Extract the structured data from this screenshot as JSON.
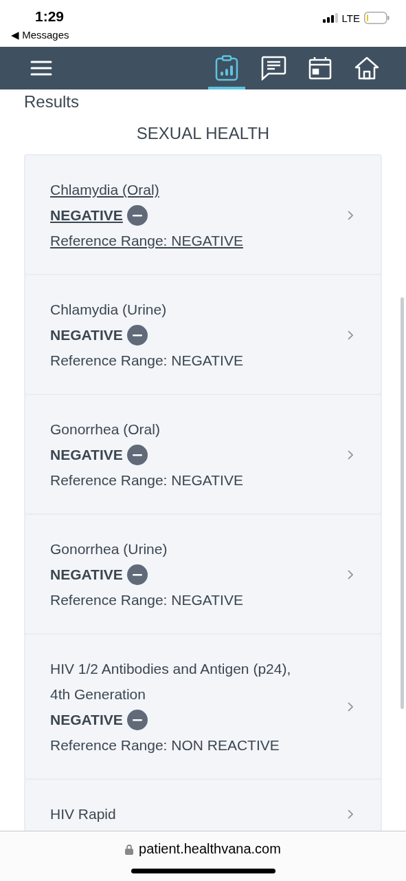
{
  "status_bar": {
    "time": "1:29",
    "back_label": "◀ Messages",
    "network": "LTE"
  },
  "nav": {
    "tabs": [
      {
        "kind": "results",
        "selected": true
      },
      {
        "kind": "messages",
        "selected": false
      },
      {
        "kind": "calendar",
        "selected": false
      },
      {
        "kind": "home",
        "selected": false
      }
    ]
  },
  "page_title": "Results",
  "section_title": "SEXUAL HEALTH",
  "results": [
    {
      "name": "Chlamydia (Oral)",
      "result": "NEGATIVE",
      "reference": "Reference Range: NEGATIVE",
      "selected": true
    },
    {
      "name": "Chlamydia (Urine)",
      "result": "NEGATIVE",
      "reference": "Reference Range: NEGATIVE",
      "selected": false
    },
    {
      "name": "Gonorrhea (Oral)",
      "result": "NEGATIVE",
      "reference": "Reference Range: NEGATIVE",
      "selected": false
    },
    {
      "name": "Gonorrhea (Urine)",
      "result": "NEGATIVE",
      "reference": "Reference Range: NEGATIVE",
      "selected": false
    },
    {
      "name": "HIV 1/2 Antibodies and Antigen (p24), 4th Generation",
      "result": "NEGATIVE",
      "reference": "Reference Range: NON REACTIVE",
      "selected": false
    },
    {
      "name": "HIV Rapid",
      "selected": false
    }
  ],
  "browser": {
    "url": "patient.healthvana.com"
  }
}
